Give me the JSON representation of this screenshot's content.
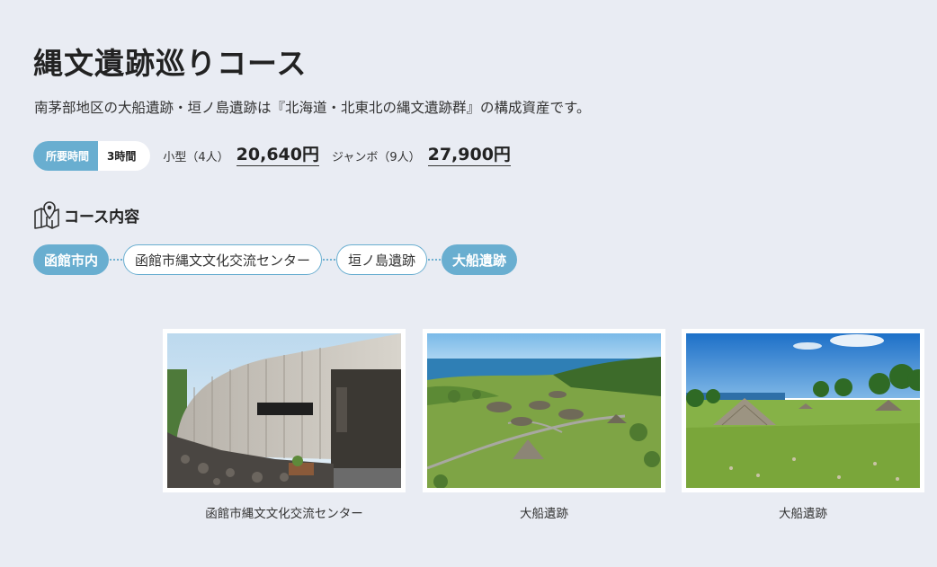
{
  "page": {
    "title": "縄文遺跡巡りコース",
    "description": "南茅部地区の大船遺跡・垣ノ島遺跡は『北海道・北東北の縄文遺跡群』の構成資産です。"
  },
  "pricing": {
    "duration_label": "所要時間",
    "duration_value": "3時間",
    "small_label": "小型（4人）",
    "small_price": "20,640円",
    "jumbo_label": "ジャンボ（9人）",
    "jumbo_price": "27,900円"
  },
  "course": {
    "heading": "コース内容",
    "icon": "map-pin-icon",
    "stops": [
      "函館市内",
      "函館市縄文文化交流センター",
      "垣ノ島遺跡",
      "大船遺跡"
    ]
  },
  "gallery": [
    {
      "caption": "函館市縄文文化交流センター"
    },
    {
      "caption": "大船遺跡"
    },
    {
      "caption": "大船遺跡"
    }
  ],
  "colors": {
    "accent": "#69aed0",
    "background": "#e9ecf3"
  }
}
